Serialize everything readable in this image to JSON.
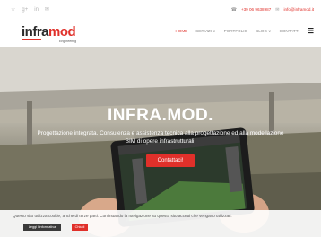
{
  "topbar": {
    "social": [
      "☆",
      "g+",
      "in",
      "✉"
    ],
    "phone_icon": "phone-icon",
    "phone": "+39 06 9638987",
    "email_icon": "mail-icon",
    "email": "info@inframod.it"
  },
  "logo": {
    "main_a": "infra",
    "main_b": "mod",
    "sub": "Engineering"
  },
  "nav": {
    "items": [
      "HOME",
      "SERVIZI ∨",
      "PORTFOLIO",
      "BLOG ∨",
      "CONTATTI"
    ],
    "menu_icon": "☰"
  },
  "hero": {
    "title": "INFRA.MOD.",
    "subtitle": "Progettazione integrata. Consulenza e assistenza tecnica alla progettazione ed alla modellazione BIM di opere infrastrutturali.",
    "cta": "Contattaci!"
  },
  "cookie": {
    "text": "Questo sito utilizza cookie, anche di terze parti. Continuando la navigazione su questo sito accetti che vengano utilizzati.",
    "more": "Leggi l'informativa",
    "close": "Chiudi"
  },
  "colors": {
    "accent": "#e0302a",
    "dark": "#2b2b2b"
  }
}
